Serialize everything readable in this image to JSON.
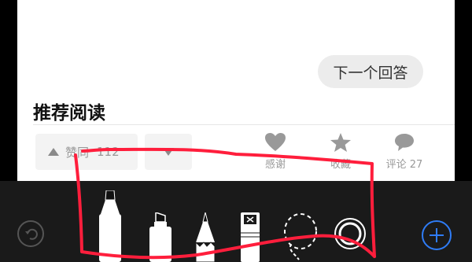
{
  "article": {
    "next_answer_label": "下一个回答",
    "section_title": "推荐阅读"
  },
  "actions": {
    "upvote_label": "赞同",
    "upvote_count": "112",
    "thanks_label": "感谢",
    "favorite_label": "收藏",
    "comment_label": "评论 27"
  },
  "toolbar": {
    "tools": [
      "marker",
      "highlighter",
      "pencil",
      "eraser",
      "lasso",
      "ruler"
    ],
    "selected_tool": "marker",
    "ink_color": "#ff1e3c",
    "accent_color": "#2f7cf6"
  },
  "icons": {
    "undo": "undo-icon",
    "add": "plus-icon",
    "thanks": "heart-icon",
    "favorite": "star-icon",
    "comment": "speech-bubble-icon"
  }
}
